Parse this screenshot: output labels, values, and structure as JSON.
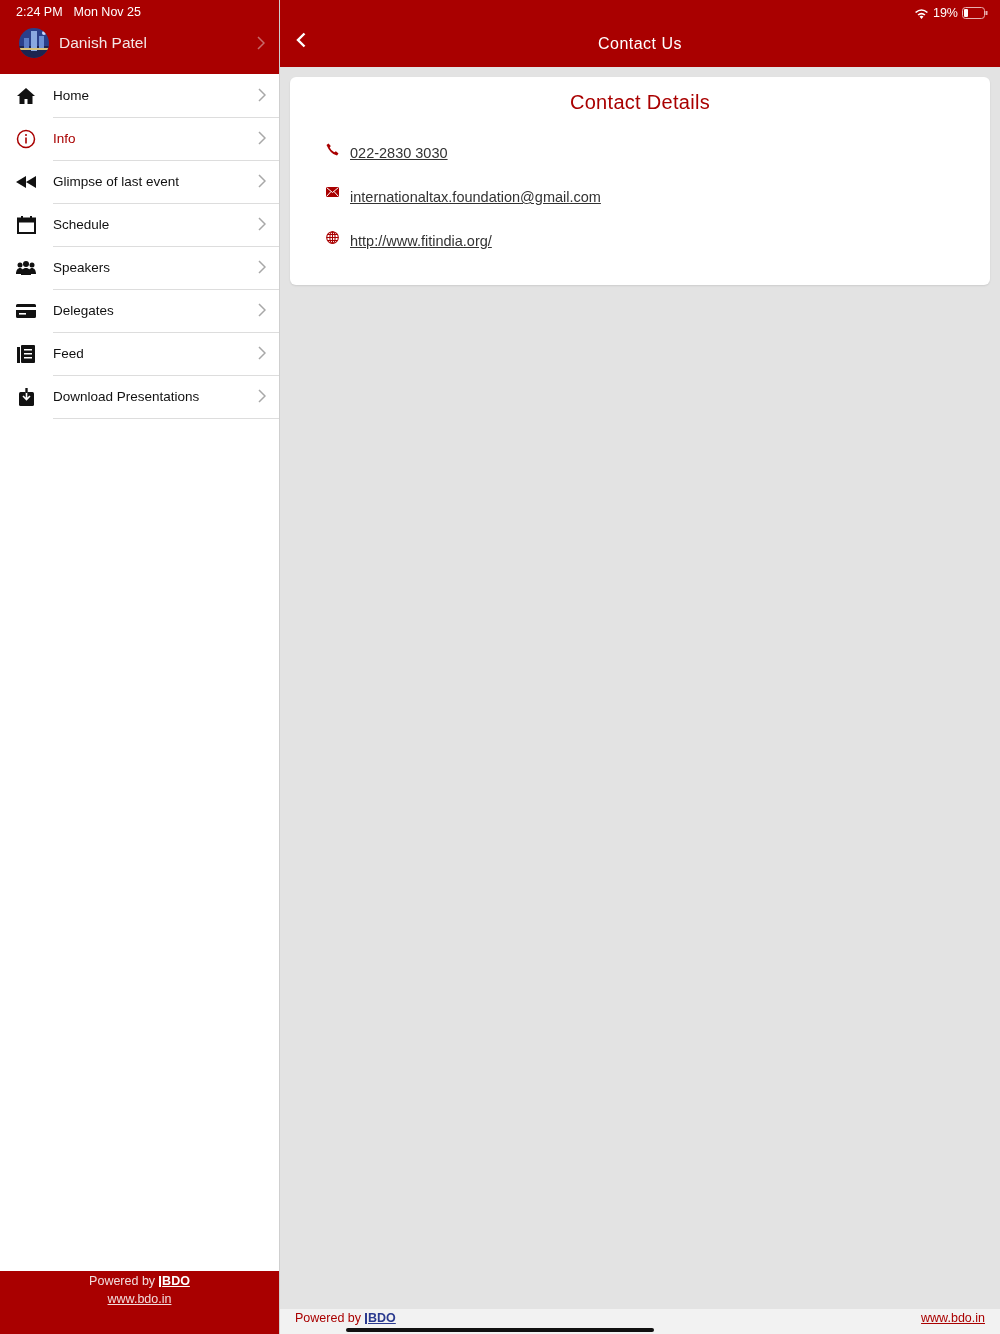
{
  "status_bar": {
    "time": "2:24 PM",
    "date": "Mon Nov 25",
    "battery": "19%"
  },
  "profile": {
    "name": "Danish Patel"
  },
  "menu": [
    {
      "label": "Home",
      "kind": "home",
      "selected": false
    },
    {
      "label": "Info",
      "kind": "info",
      "selected": true
    },
    {
      "label": "Glimpse of last event",
      "kind": "rewind",
      "selected": false
    },
    {
      "label": "Schedule",
      "kind": "calendar",
      "selected": false
    },
    {
      "label": "Speakers",
      "kind": "people",
      "selected": false
    },
    {
      "label": "Delegates",
      "kind": "card",
      "selected": false
    },
    {
      "label": "Feed",
      "kind": "feed",
      "selected": false
    },
    {
      "label": "Download Presentations",
      "kind": "download",
      "selected": false
    }
  ],
  "sidebar_footer": {
    "powered_by": "Powered by",
    "logo": "BDO",
    "link": "www.bdo.in"
  },
  "header": {
    "title": "Contact Us"
  },
  "contact_card": {
    "title": "Contact Details",
    "items": [
      {
        "kind": "phone",
        "text": "022-2830 3030"
      },
      {
        "kind": "email",
        "text": "internationaltax.foundation@gmail.com"
      },
      {
        "kind": "web",
        "text": "http://www.fitindia.org/"
      }
    ]
  },
  "main_footer": {
    "powered_by": "Powered by",
    "logo": "BDO",
    "link": "www.bdo.in"
  }
}
